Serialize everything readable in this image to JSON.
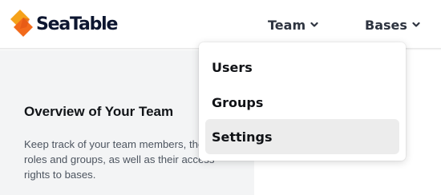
{
  "header": {
    "logo_text": "SeaTable",
    "logo_icon": "seatable-logo-icon",
    "brand_colors": {
      "orange": "#ff8a00",
      "dark": "#0d1630"
    },
    "nav": [
      {
        "label": "Team",
        "icon": "chevron-down-icon"
      },
      {
        "label": "Bases",
        "icon": "chevron-down-icon"
      }
    ]
  },
  "dropdown": {
    "items": [
      {
        "label": "Users"
      },
      {
        "label": "Groups"
      },
      {
        "label": "Settings",
        "highlighted": true
      }
    ]
  },
  "main": {
    "overview_title": "Overview of Your Team",
    "overview_text": "Keep track of your team members, their roles and groups, as well as their access rights to bases."
  }
}
